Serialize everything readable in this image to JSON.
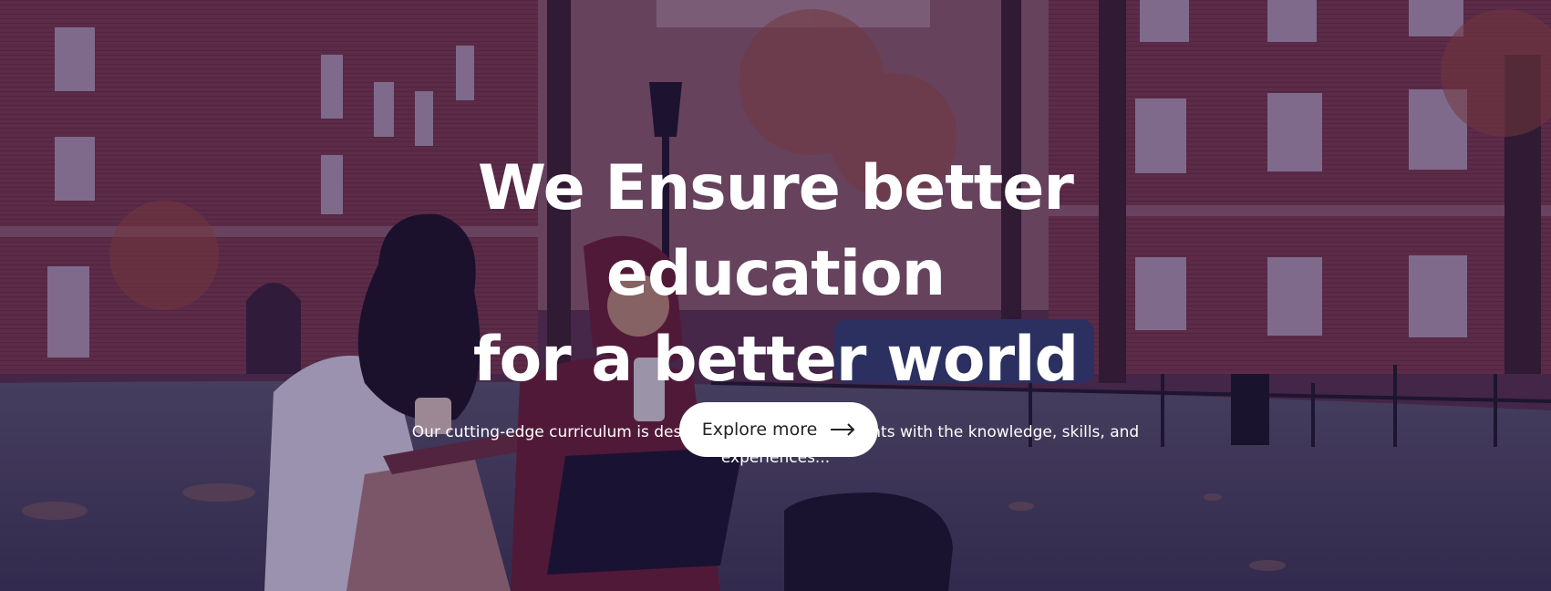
{
  "hero": {
    "title_line1": "We Ensure better education",
    "title_line2": "for a better world",
    "subtitle_line1": "Our cutting-edge curriculum is designed to empower students with the knowledge, skills, and",
    "subtitle_line2": "experiences...",
    "button_label": "Explore more",
    "button_icon": "arrow-right-icon",
    "background_image": "students-studying-on-campus-lawn",
    "overlay_color": "#1c0e48"
  }
}
